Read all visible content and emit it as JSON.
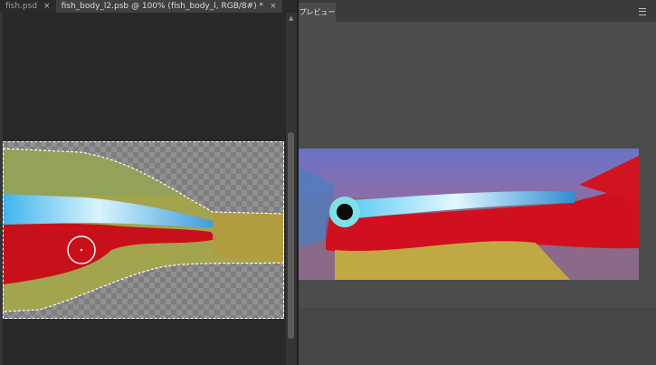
{
  "document_tabs": [
    {
      "label": "fish.psd",
      "active": false,
      "close": "×"
    },
    {
      "label": "fish_body_l2.psb @ 100% (fish_body_l, RGB/8#) *",
      "active": true,
      "close": "×"
    }
  ],
  "scrollbar": {
    "arrow": "▲"
  },
  "preview_panel": {
    "tab_label": "プレビュー",
    "menu_icon": "panel-menu-icon"
  },
  "colors": {
    "fish_red": "#c8101a",
    "neon_stripe": "#2a9de0",
    "body_olive": "#a8a84a",
    "panel_bg": "#4c4c4c",
    "canvas_bg": "#282828"
  }
}
